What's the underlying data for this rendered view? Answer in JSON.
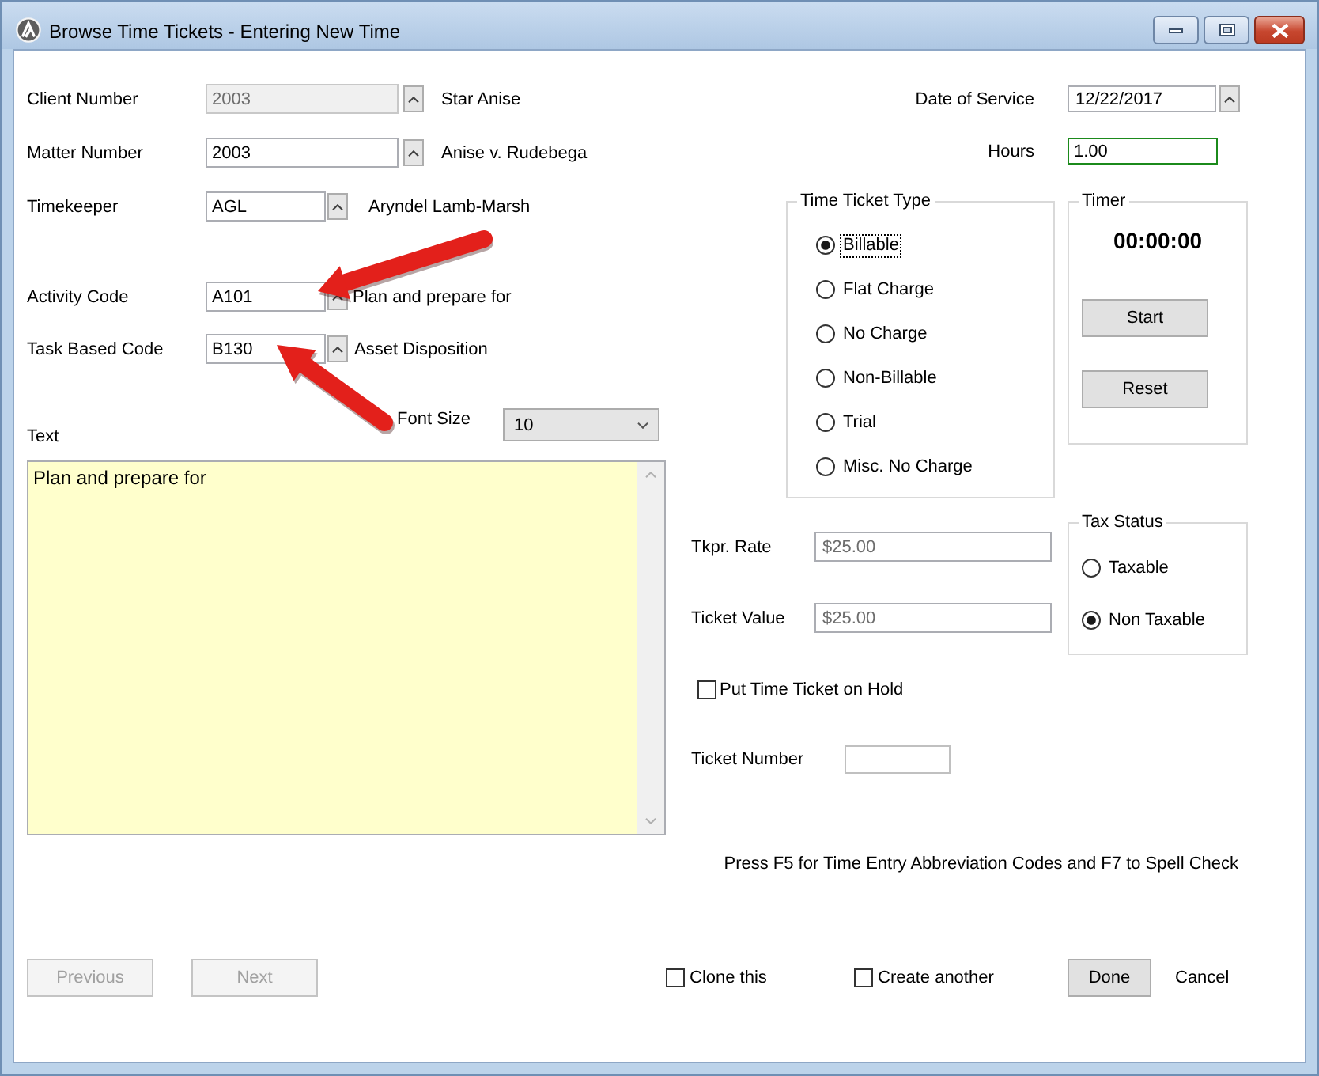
{
  "window": {
    "title": "Browse Time Tickets - Entering New Time"
  },
  "lookups": [
    {
      "label": "Client Number",
      "value": "2003",
      "disabled": true,
      "description": "Star Anise"
    },
    {
      "label": "Matter Number",
      "value": "2003",
      "disabled": false,
      "description": "Anise v. Rudebega"
    },
    {
      "label": "Timekeeper",
      "value": "AGL",
      "disabled": false,
      "description": "Aryndel Lamb-Marsh"
    },
    {
      "label": "Activity Code",
      "value": "A101",
      "disabled": false,
      "description": "Plan and prepare for"
    },
    {
      "label": "Task Based Code",
      "value": "B130",
      "disabled": false,
      "description": "Asset Disposition"
    }
  ],
  "date_of_service": {
    "label": "Date of Service",
    "value": "12/22/2017"
  },
  "hours": {
    "label": "Hours",
    "value": "1.00",
    "focused": true
  },
  "font_size": {
    "label": "Font Size",
    "value": "10"
  },
  "text": {
    "label": "Text",
    "value": "Plan and prepare for"
  },
  "ticket_type": {
    "title": "Time Ticket Type",
    "options": [
      {
        "label": "Billable",
        "selected": true,
        "focused": true
      },
      {
        "label": "Flat Charge",
        "selected": false,
        "focused": false
      },
      {
        "label": "No Charge",
        "selected": false,
        "focused": false
      },
      {
        "label": "Non-Billable",
        "selected": false,
        "focused": false
      },
      {
        "label": "Trial",
        "selected": false,
        "focused": false
      },
      {
        "label": "Misc. No Charge",
        "selected": false,
        "focused": false
      }
    ]
  },
  "timer": {
    "title": "Timer",
    "time": "00:00:00",
    "buttons": [
      {
        "label": "Start"
      },
      {
        "label": "Reset"
      }
    ]
  },
  "rates": [
    {
      "label": "Tkpr. Rate",
      "value": "$25.00",
      "read_only": true
    },
    {
      "label": "Ticket Value",
      "value": "$25.00",
      "read_only": true
    }
  ],
  "tax_status": {
    "title": "Tax Status",
    "options": [
      {
        "label": "Taxable",
        "selected": false
      },
      {
        "label": "Non Taxable",
        "selected": true
      }
    ]
  },
  "hold": {
    "label": "Put Time Ticket on Hold",
    "checked": false
  },
  "ticket_number": {
    "label": "Ticket Number"
  },
  "hint": "Press F5 for Time Entry Abbreviation Codes and F7 to Spell Check",
  "footer": {
    "nav_buttons": [
      {
        "label": "Previous",
        "disabled": true
      },
      {
        "label": "Next",
        "disabled": true
      }
    ],
    "checkboxes": [
      {
        "label": "Clone this",
        "checked": false
      },
      {
        "label": "Create another",
        "checked": false
      }
    ],
    "done": {
      "label": "Done"
    },
    "cancel": {
      "label": "Cancel"
    }
  }
}
